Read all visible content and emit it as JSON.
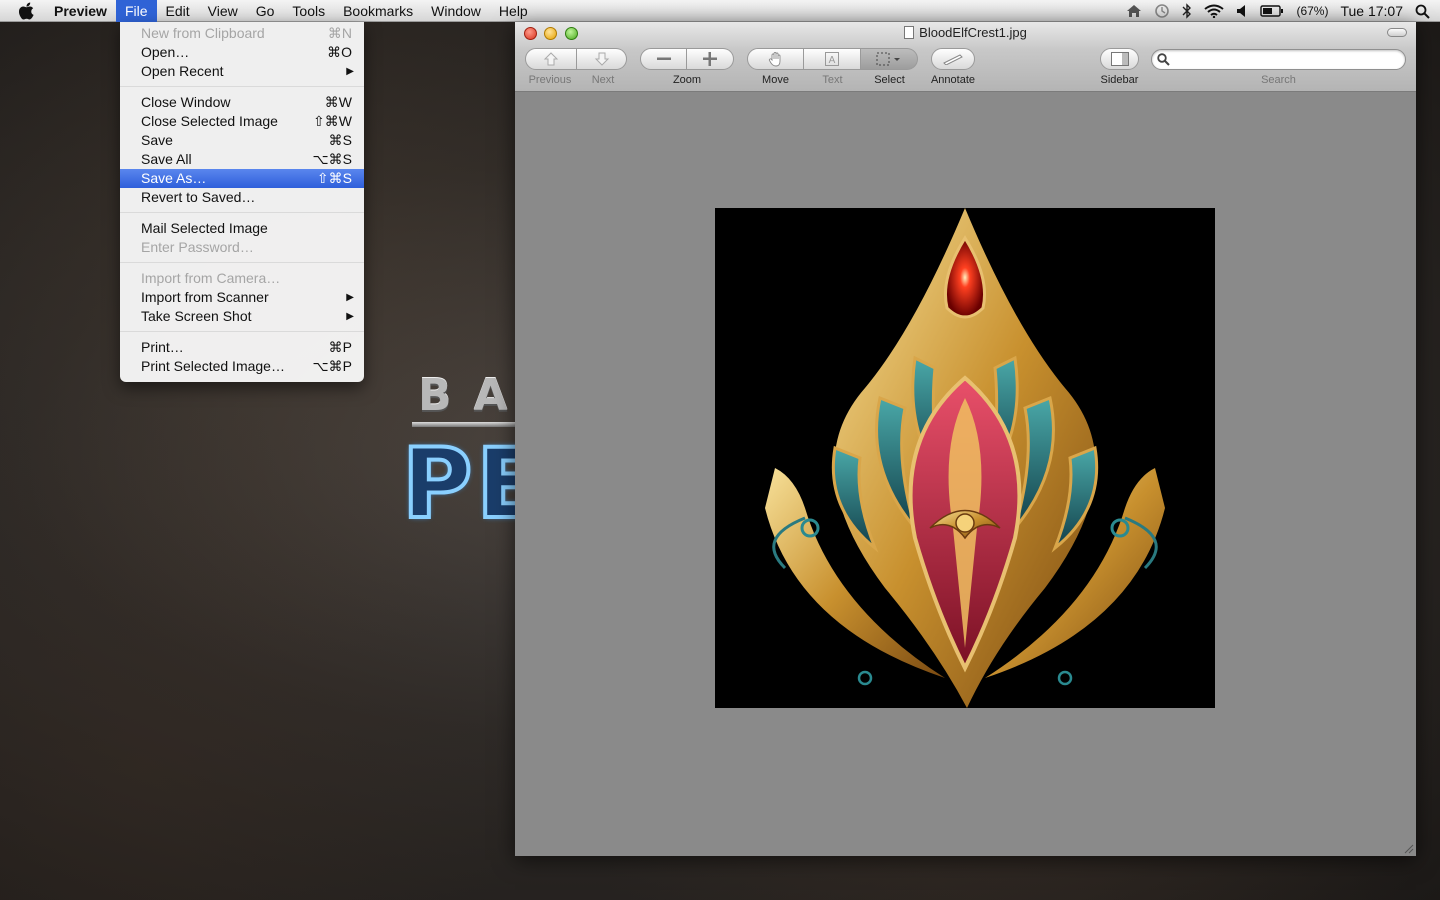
{
  "menubar": {
    "app_name": "Preview",
    "menus": [
      "File",
      "Edit",
      "View",
      "Go",
      "Tools",
      "Bookmarks",
      "Window",
      "Help"
    ],
    "active_menu": "File",
    "status": {
      "battery": "(67%)",
      "clock": "Tue 17:07"
    }
  },
  "file_menu": {
    "groups": [
      [
        {
          "label": "New from Clipboard",
          "shortcut": "⌘N",
          "enabled": false
        },
        {
          "label": "Open…",
          "shortcut": "⌘O",
          "enabled": true
        },
        {
          "label": "Open Recent",
          "submenu": true,
          "enabled": true
        }
      ],
      [
        {
          "label": "Close Window",
          "shortcut": "⌘W",
          "enabled": true
        },
        {
          "label": "Close Selected Image",
          "shortcut": "⇧⌘W",
          "enabled": true
        },
        {
          "label": "Save",
          "shortcut": "⌘S",
          "enabled": true
        },
        {
          "label": "Save All",
          "shortcut": "⌥⌘S",
          "enabled": true
        },
        {
          "label": "Save As…",
          "shortcut": "⇧⌘S",
          "enabled": true,
          "highlighted": true
        },
        {
          "label": "Revert to Saved…",
          "enabled": true
        }
      ],
      [
        {
          "label": "Mail Selected Image",
          "enabled": true
        },
        {
          "label": "Enter Password…",
          "enabled": false
        }
      ],
      [
        {
          "label": "Import from Camera…",
          "enabled": false
        },
        {
          "label": "Import from Scanner",
          "submenu": true,
          "enabled": true
        },
        {
          "label": "Take Screen Shot",
          "submenu": true,
          "enabled": true
        }
      ],
      [
        {
          "label": "Print…",
          "shortcut": "⌘P",
          "enabled": true
        },
        {
          "label": "Print Selected Image…",
          "shortcut": "⌥⌘P",
          "enabled": true
        }
      ]
    ]
  },
  "window": {
    "title": "BloodElfCrest1.jpg",
    "toolbar": {
      "previous": "Previous",
      "next": "Next",
      "zoom": "Zoom",
      "move": "Move",
      "text": "Text",
      "select": "Select",
      "annotate": "Annotate",
      "sidebar": "Sidebar",
      "search": "Search"
    },
    "search": {
      "value": "",
      "placeholder": ""
    }
  },
  "desktop": {
    "logo_top": "BA",
    "logo_big": "PE"
  }
}
